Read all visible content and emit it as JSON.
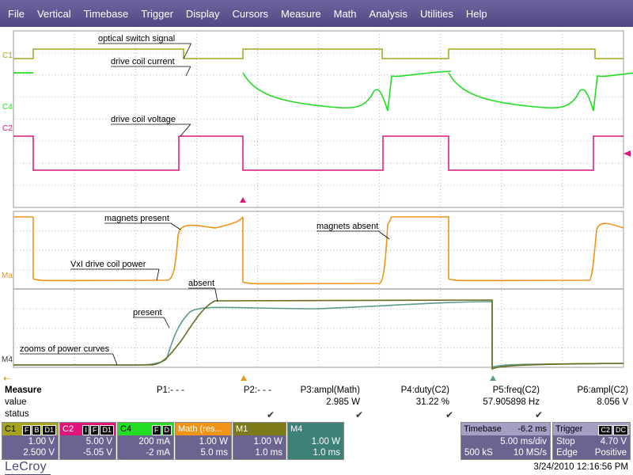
{
  "menu": [
    "File",
    "Vertical",
    "Timebase",
    "Trigger",
    "Display",
    "Cursors",
    "Measure",
    "Math",
    "Analysis",
    "Utilities",
    "Help"
  ],
  "traces": {
    "c1": {
      "label": "C1",
      "color": "#a6a41c"
    },
    "c4": {
      "label": "C4",
      "color": "#22dd22"
    },
    "c2": {
      "label": "C2",
      "color": "#e0157a"
    },
    "ma": {
      "label": "Ma",
      "color": "#f09416"
    },
    "m4": {
      "label": "M4",
      "color": "#5a9b8e"
    }
  },
  "annotations": {
    "optical": "optical switch signal",
    "current": "drive coil current",
    "voltage": "drive coil voltage",
    "present": "magnets present",
    "absent": "magnets absent",
    "power": "VxI drive coil power",
    "absent_zoom": "absent",
    "present_zoom": "present",
    "zooms": "zooms of power curves"
  },
  "measure": {
    "title": "Measure",
    "value_label": "value",
    "status_label": "status",
    "params": [
      {
        "name": "P1:- - -",
        "value": "",
        "status": false
      },
      {
        "name": "P2:- - -",
        "value": "",
        "status": false
      },
      {
        "name": "P3:ampl(Math)",
        "value": "2.985 W",
        "status": true
      },
      {
        "name": "P4:duty(C2)",
        "value": "31.22 %",
        "status": true
      },
      {
        "name": "P5:freq(C2)",
        "value": "57.905898 Hz",
        "status": true
      },
      {
        "name": "P6:ampl(C2)",
        "value": "8.056 V",
        "status": true
      }
    ]
  },
  "channels": [
    {
      "id": "c1",
      "name": "C1",
      "flags": [
        "F",
        "B",
        "D1"
      ],
      "v1": "1.00 V",
      "v2": "2.500 V",
      "color": "#a6a41c"
    },
    {
      "id": "c2",
      "name": "C2",
      "flags": [
        "I",
        "F",
        "D1"
      ],
      "v1": "5.00 V",
      "v2": "-5.05 V",
      "color": "#e0157a"
    },
    {
      "id": "c4",
      "name": "C4",
      "flags": [
        "F",
        "D"
      ],
      "v1": "200 mA",
      "v2": "-2 mA",
      "color": "#22dd22"
    },
    {
      "id": "math",
      "name": "Math",
      "sub": "(res...",
      "v1": "1.00 W",
      "v2": "5.0 ms",
      "color": "#f09416"
    },
    {
      "id": "m1",
      "name": "M1",
      "v1": "1.00 W",
      "v2": "1.0 ms",
      "color": "#7d7a1a"
    },
    {
      "id": "m4",
      "name": "M4",
      "v1": "1.00 W",
      "v2": "1.0 ms",
      "color": "#3d8077"
    }
  ],
  "timebase": {
    "label": "Timebase",
    "offset": "-6.2 ms",
    "div": "5.00 ms/div",
    "samples": "500 kS",
    "rate": "10 MS/s"
  },
  "trigger": {
    "label": "Trigger",
    "flags": [
      "C2",
      "DC"
    ],
    "mode": "Stop",
    "level": "4.70 V",
    "type": "Edge",
    "slope": "Positive"
  },
  "brand": "LeCroy",
  "timestamp": "3/24/2010 12:16:56 PM"
}
